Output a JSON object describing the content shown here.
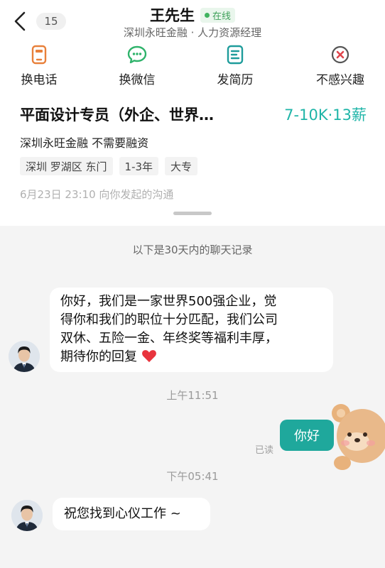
{
  "header": {
    "unread_count": "15",
    "contact_name": "王先生",
    "status": "在线",
    "subtitle": "深圳永旺金融 · 人力资源经理"
  },
  "actions": [
    {
      "label": "换电话",
      "icon": "phone-card-icon"
    },
    {
      "label": "换微信",
      "icon": "wechat-icon"
    },
    {
      "label": "发简历",
      "icon": "resume-icon"
    },
    {
      "label": "不感兴趣",
      "icon": "not-interested-icon"
    }
  ],
  "job": {
    "title": "平面设计专员（外企、世界…",
    "salary": "7-10K·13薪",
    "company_line": "深圳永旺金融 不需要融资",
    "tags": [
      "深圳 罗湖区 东门",
      "1-3年",
      "大专"
    ],
    "initiated": "6月23日 23:10 向你发起的沟通"
  },
  "chat": {
    "history_note": "以下是30天内的聊天记录",
    "msg1_lines": [
      "你好，我们是一家世界500强企业，觉",
      "得你和我们的职位十分匹配，我们公司",
      "双休、五险一金、年终奖等福利丰厚，",
      "期待你的回复"
    ],
    "time1": "上午11:51",
    "reply": "你好",
    "read_status": "已读",
    "time2": "下午05:41",
    "msg2": "祝您找到心仪工作 ~"
  },
  "colors": {
    "accent": "#1fa89c",
    "online": "#3fa15a",
    "icon_orange": "#e8803a",
    "icon_green": "#2fb36b",
    "icon_teal": "#1e9c9b",
    "icon_red": "#e0454c"
  }
}
